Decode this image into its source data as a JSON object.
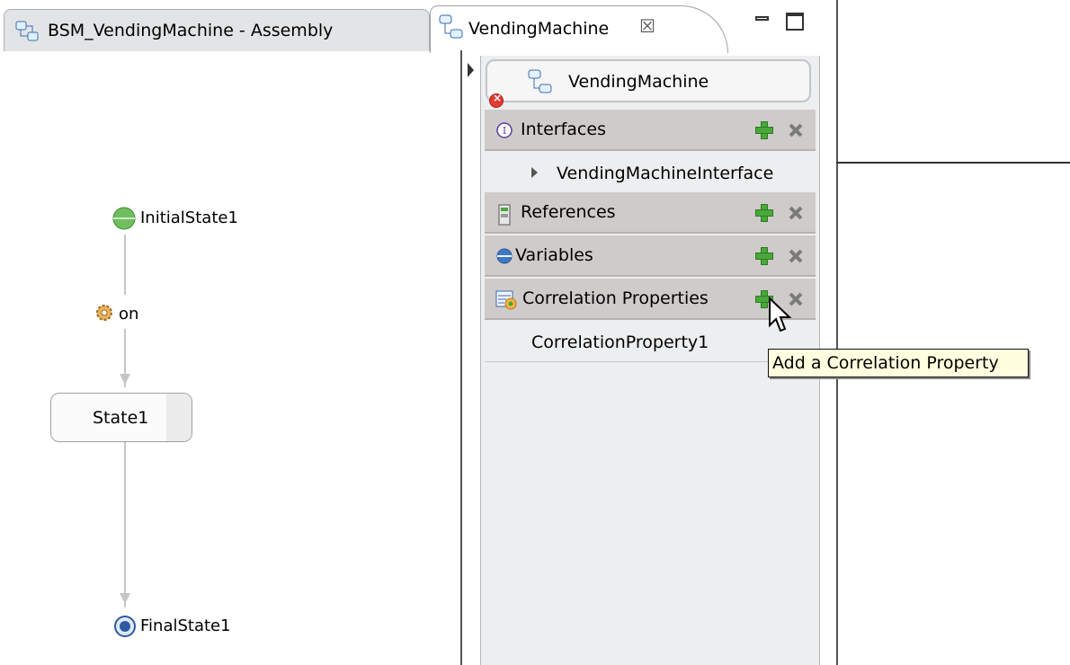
{
  "tabs": [
    {
      "label": "BSM_VendingMachine - Assembly",
      "icon": "assembly-icon"
    },
    {
      "label": "VendingMachine",
      "icon": "state-machine-icon",
      "active": true
    }
  ],
  "panel": {
    "title": "VendingMachine",
    "sections": {
      "interfaces": {
        "label": "Interfaces",
        "item": "VendingMachineInterface"
      },
      "references": {
        "label": "References"
      },
      "variables": {
        "label": "Variables"
      },
      "correlation": {
        "label": "Correlation Properties",
        "item": "CorrelationProperty1"
      }
    }
  },
  "diagram": {
    "initial": "InitialState1",
    "transition": "on",
    "state": "State1",
    "final": "FinalState1"
  },
  "tooltip": "Add a Correlation Property",
  "colors": {
    "add": "#4aa73a",
    "section_bg": "#cfcbca",
    "panel_bg": "#edeeef",
    "tooltip_bg": "#ffffdf"
  }
}
